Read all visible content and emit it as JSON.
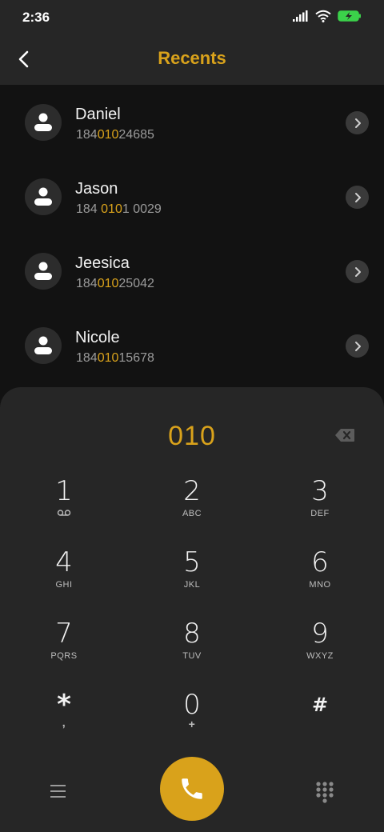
{
  "status": {
    "time": "2:36"
  },
  "header": {
    "title": "Recents"
  },
  "recents": [
    {
      "name": "Daniel",
      "number_parts": [
        "184",
        "010",
        "24685"
      ]
    },
    {
      "name": "Jason",
      "number_parts": [
        "184 ",
        "010",
        "1 0029"
      ]
    },
    {
      "name": "Jeesica",
      "number_parts": [
        "184",
        "010",
        "25042"
      ]
    },
    {
      "name": "Nicole",
      "number_parts": [
        "184",
        "010",
        "15678"
      ]
    }
  ],
  "dialer": {
    "input_value": "010",
    "keys": [
      {
        "digit": "1",
        "letters": ""
      },
      {
        "digit": "2",
        "letters": "ABC"
      },
      {
        "digit": "3",
        "letters": "DEF"
      },
      {
        "digit": "4",
        "letters": "GHI"
      },
      {
        "digit": "5",
        "letters": "JKL"
      },
      {
        "digit": "6",
        "letters": "MNO"
      },
      {
        "digit": "7",
        "letters": "PQRS"
      },
      {
        "digit": "8",
        "letters": "TUV"
      },
      {
        "digit": "9",
        "letters": "WXYZ"
      },
      {
        "digit": "*",
        "letters": ","
      },
      {
        "digit": "0",
        "letters": "+"
      },
      {
        "digit": "#",
        "letters": ""
      }
    ]
  },
  "colors": {
    "accent": "#d9a21b",
    "background": "#121212",
    "panel": "#262626"
  },
  "icons": {
    "back": "chevron-left-icon",
    "detail": "chevron-right-icon",
    "avatar": "person-icon",
    "backspace": "backspace-icon",
    "voicemail": "voicemail-icon",
    "menu": "menu-icon",
    "call": "phone-icon",
    "keypad": "dialpad-icon"
  }
}
